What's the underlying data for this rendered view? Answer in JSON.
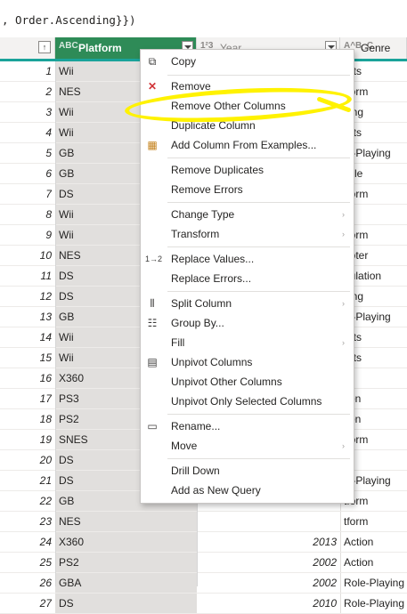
{
  "formula_bar": {
    "text": ", Order.Ascending}})"
  },
  "columns": {
    "platform": {
      "label": "Platform",
      "type_icon": "ABC"
    },
    "year": {
      "label": "Year",
      "type_icon": "1²3"
    },
    "genre": {
      "label": "Genre",
      "type_icon": "A^B_C"
    }
  },
  "rows": [
    {
      "i": "1",
      "p": "Wii",
      "y": "",
      "g": "orts"
    },
    {
      "i": "2",
      "p": "NES",
      "y": "",
      "g": "tform"
    },
    {
      "i": "3",
      "p": "Wii",
      "y": "",
      "g": "cing"
    },
    {
      "i": "4",
      "p": "Wii",
      "y": "",
      "g": "orts"
    },
    {
      "i": "5",
      "p": "GB",
      "y": "",
      "g": "le-Playing"
    },
    {
      "i": "6",
      "p": "GB",
      "y": "",
      "g": "zzle"
    },
    {
      "i": "7",
      "p": "DS",
      "y": "",
      "g": "tform"
    },
    {
      "i": "8",
      "p": "Wii",
      "y": "",
      "g": "sc"
    },
    {
      "i": "9",
      "p": "Wii",
      "y": "",
      "g": "tform"
    },
    {
      "i": "10",
      "p": "NES",
      "y": "",
      "g": "ooter"
    },
    {
      "i": "11",
      "p": "DS",
      "y": "",
      "g": "nulation"
    },
    {
      "i": "12",
      "p": "DS",
      "y": "",
      "g": "cing"
    },
    {
      "i": "13",
      "p": "GB",
      "y": "",
      "g": "le-Playing"
    },
    {
      "i": "14",
      "p": "Wii",
      "y": "",
      "g": "orts"
    },
    {
      "i": "15",
      "p": "Wii",
      "y": "",
      "g": "orts"
    },
    {
      "i": "16",
      "p": "X360",
      "y": "",
      "g": "sc"
    },
    {
      "i": "17",
      "p": "PS3",
      "y": "",
      "g": "tion"
    },
    {
      "i": "18",
      "p": "PS2",
      "y": "",
      "g": "tion"
    },
    {
      "i": "19",
      "p": "SNES",
      "y": "",
      "g": "tform"
    },
    {
      "i": "20",
      "p": "DS",
      "y": "",
      "g": "sc"
    },
    {
      "i": "21",
      "p": "DS",
      "y": "",
      "g": "le-Playing"
    },
    {
      "i": "22",
      "p": "GB",
      "y": "",
      "g": "tform"
    },
    {
      "i": "23",
      "p": "NES",
      "y": "",
      "g": "tform"
    },
    {
      "i": "24",
      "p": "X360",
      "y": "2013",
      "g": "Action"
    },
    {
      "i": "25",
      "p": "PS2",
      "y": "2002",
      "g": "Action"
    },
    {
      "i": "26",
      "p": "GBA",
      "y": "2002",
      "g": "Role-Playing"
    },
    {
      "i": "27",
      "p": "DS",
      "y": "2010",
      "g": "Role-Playing"
    }
  ],
  "menu": {
    "copy": "Copy",
    "remove": "Remove",
    "remove_other": "Remove Other Columns",
    "duplicate": "Duplicate Column",
    "add_from_examples": "Add Column From Examples...",
    "remove_duplicates": "Remove Duplicates",
    "remove_errors": "Remove Errors",
    "change_type": "Change Type",
    "transform": "Transform",
    "replace_values": "Replace Values...",
    "replace_errors": "Replace Errors...",
    "split_column": "Split Column",
    "group_by": "Group By...",
    "fill": "Fill",
    "unpivot": "Unpivot Columns",
    "unpivot_other": "Unpivot Other Columns",
    "unpivot_selected": "Unpivot Only Selected Columns",
    "rename": "Rename...",
    "move": "Move",
    "drill_down": "Drill Down",
    "add_as_query": "Add as New Query"
  },
  "colors": {
    "selected_header": "#2e8b57",
    "accent_line": "#1aa39a",
    "highlight": "#fff200"
  }
}
